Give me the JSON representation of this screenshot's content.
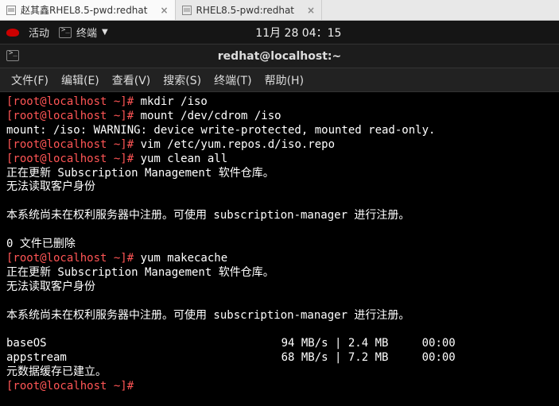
{
  "tabs": [
    {
      "label": "赵其鑫RHEL8.5-pwd:redhat",
      "active": true
    },
    {
      "label": "RHEL8.5-pwd:redhat",
      "active": false
    }
  ],
  "topbar": {
    "activities": "活动",
    "terminal": "终端",
    "clock": "11月 28 04：15"
  },
  "window": {
    "title": "redhat@localhost:~"
  },
  "menu": {
    "file": "文件(F)",
    "edit": "编辑(E)",
    "view": "查看(V)",
    "search": "搜索(S)",
    "terminal": "终端(T)",
    "help": "帮助(H)"
  },
  "term": {
    "prompt": "[root@localhost ~]# ",
    "lines": [
      {
        "p": true,
        "t": "mkdir /iso"
      },
      {
        "p": true,
        "t": "mount /dev/cdrom /iso"
      },
      {
        "p": false,
        "t": "mount: /iso: WARNING: device write-protected, mounted read-only."
      },
      {
        "p": true,
        "t": "vim /etc/yum.repos.d/iso.repo"
      },
      {
        "p": true,
        "t": "yum clean all"
      },
      {
        "p": false,
        "t": "正在更新 Subscription Management 软件仓库。"
      },
      {
        "p": false,
        "t": "无法读取客户身份"
      },
      {
        "p": false,
        "t": ""
      },
      {
        "p": false,
        "t": "本系统尚未在权利服务器中注册。可使用 subscription-manager 进行注册。"
      },
      {
        "p": false,
        "t": ""
      },
      {
        "p": false,
        "t": "0 文件已删除"
      },
      {
        "p": true,
        "t": "yum makecache"
      },
      {
        "p": false,
        "t": "正在更新 Subscription Management 软件仓库。"
      },
      {
        "p": false,
        "t": "无法读取客户身份"
      },
      {
        "p": false,
        "t": ""
      },
      {
        "p": false,
        "t": "本系统尚未在权利服务器中注册。可使用 subscription-manager 进行注册。"
      },
      {
        "p": false,
        "t": ""
      },
      {
        "p": false,
        "t": "baseOS                                   94 MB/s | 2.4 MB     00:00"
      },
      {
        "p": false,
        "t": "appstream                                68 MB/s | 7.2 MB     00:00"
      },
      {
        "p": false,
        "t": "元数据缓存已建立。"
      },
      {
        "p": true,
        "t": ""
      }
    ]
  }
}
